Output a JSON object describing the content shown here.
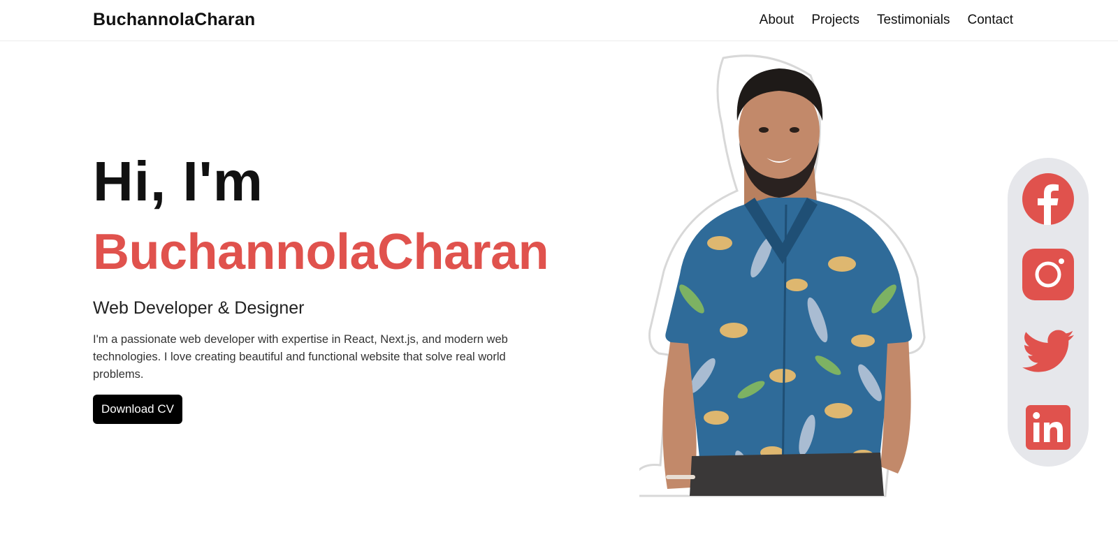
{
  "header": {
    "brand": "BuchannolaCharan",
    "nav": [
      "About",
      "Projects",
      "Testimonials",
      "Contact"
    ]
  },
  "hero": {
    "greeting": "Hi, I'm",
    "name": "BuchannolaCharan",
    "role": "Web Developer & Designer",
    "bio": "I'm a passionate web developer with expertise in React, Next.js, and modern web technologies. I love creating beautiful and functional website that solve real world problems.",
    "cta_label": "Download CV"
  },
  "social": {
    "icons": [
      "facebook-icon",
      "instagram-icon",
      "twitter-icon",
      "linkedin-icon"
    ]
  },
  "colors": {
    "accent": "#e0524d",
    "dark": "#000000",
    "social_bg": "#e6e7eb"
  }
}
